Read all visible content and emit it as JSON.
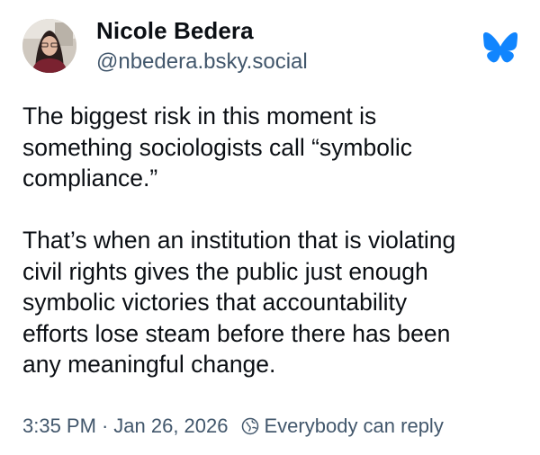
{
  "author": {
    "display_name": "Nicole Bedera",
    "handle": "@nbedera.bsky.social"
  },
  "post": {
    "paragraphs": [
      "The biggest risk in this moment is\nsomething sociologists call “symbolic\ncompliance.”",
      "That’s when an institution that is violating\ncivil rights gives the public just enough\nsymbolic victories that accountability\nefforts lose steam before there has been\nany meaningful change."
    ]
  },
  "meta": {
    "time": "3:35 PM",
    "separator": "·",
    "date": "Jan 26, 2026",
    "reply_setting": "Everybody can reply"
  },
  "icons": {
    "brand": "bluesky-butterfly-icon",
    "reply": "globe-icon"
  },
  "colors": {
    "brand_blue": "#1185fe",
    "text_primary": "#0b0f14",
    "text_secondary": "#42576c"
  }
}
